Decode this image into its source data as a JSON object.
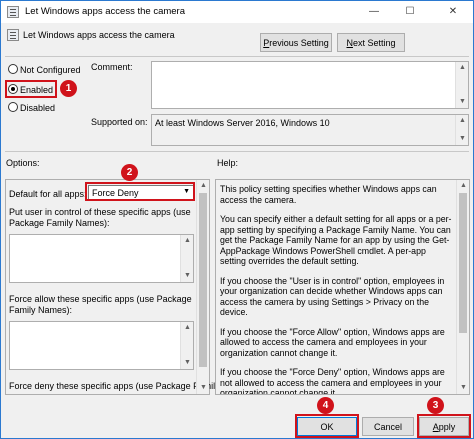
{
  "window": {
    "title": "Let Windows apps access the camera",
    "minimize_glyph": "—",
    "maximize_glyph": "☐",
    "close_glyph": "✕"
  },
  "header": {
    "policy_title": "Let Windows apps access the camera",
    "previous_label_u": "P",
    "previous_label_rest": "revious Setting",
    "next_label_u": "N",
    "next_label_rest": "ext Setting"
  },
  "state": {
    "options": [
      {
        "label": "Not Configured",
        "label_u": "C",
        "selected": false
      },
      {
        "label": "Enabled",
        "label_u": "E",
        "selected": true
      },
      {
        "label": "Disabled",
        "label_u": "D",
        "selected": false
      }
    ]
  },
  "comment": {
    "label": "Comment:",
    "value": ""
  },
  "supported": {
    "label": "Supported on:",
    "value": "At least Windows Server 2016, Windows 10"
  },
  "options_pane": {
    "heading": "Options:",
    "default_label": "Default for all apps:",
    "default_value": "Force Deny",
    "user_control_label": "Put user in control of these specific apps (use Package Family Names):",
    "force_allow_label": "Force allow these specific apps (use Package Family Names):",
    "force_deny_label": "Force deny these specific apps (use Package Family"
  },
  "help_pane": {
    "heading": "Help:",
    "paragraphs": [
      "This policy setting specifies whether Windows apps can access the camera.",
      "You can specify either a default setting for all apps or a per-app setting by specifying a Package Family Name. You can get the Package Family Name for an app by using the Get-AppPackage Windows PowerShell cmdlet. A per-app setting overrides the default setting.",
      "If you choose the \"User is in control\" option, employees in your organization can decide whether Windows apps can access the camera by using Settings > Privacy on the device.",
      "If you choose the \"Force Allow\" option, Windows apps are allowed to access the camera and employees in your organization cannot change it.",
      "If you choose the \"Force Deny\" option, Windows apps are not allowed to access the camera and employees in your organization cannot change it."
    ]
  },
  "footer": {
    "ok_label": "OK",
    "cancel_label": "Cancel",
    "apply_label_u": "A",
    "apply_label_rest": "pply"
  },
  "markers": [
    "1",
    "2",
    "3",
    "4"
  ],
  "colors": {
    "marker": "#d0131b",
    "window_border": "#2b79d0",
    "dialog_bg": "#f0f0f0"
  }
}
